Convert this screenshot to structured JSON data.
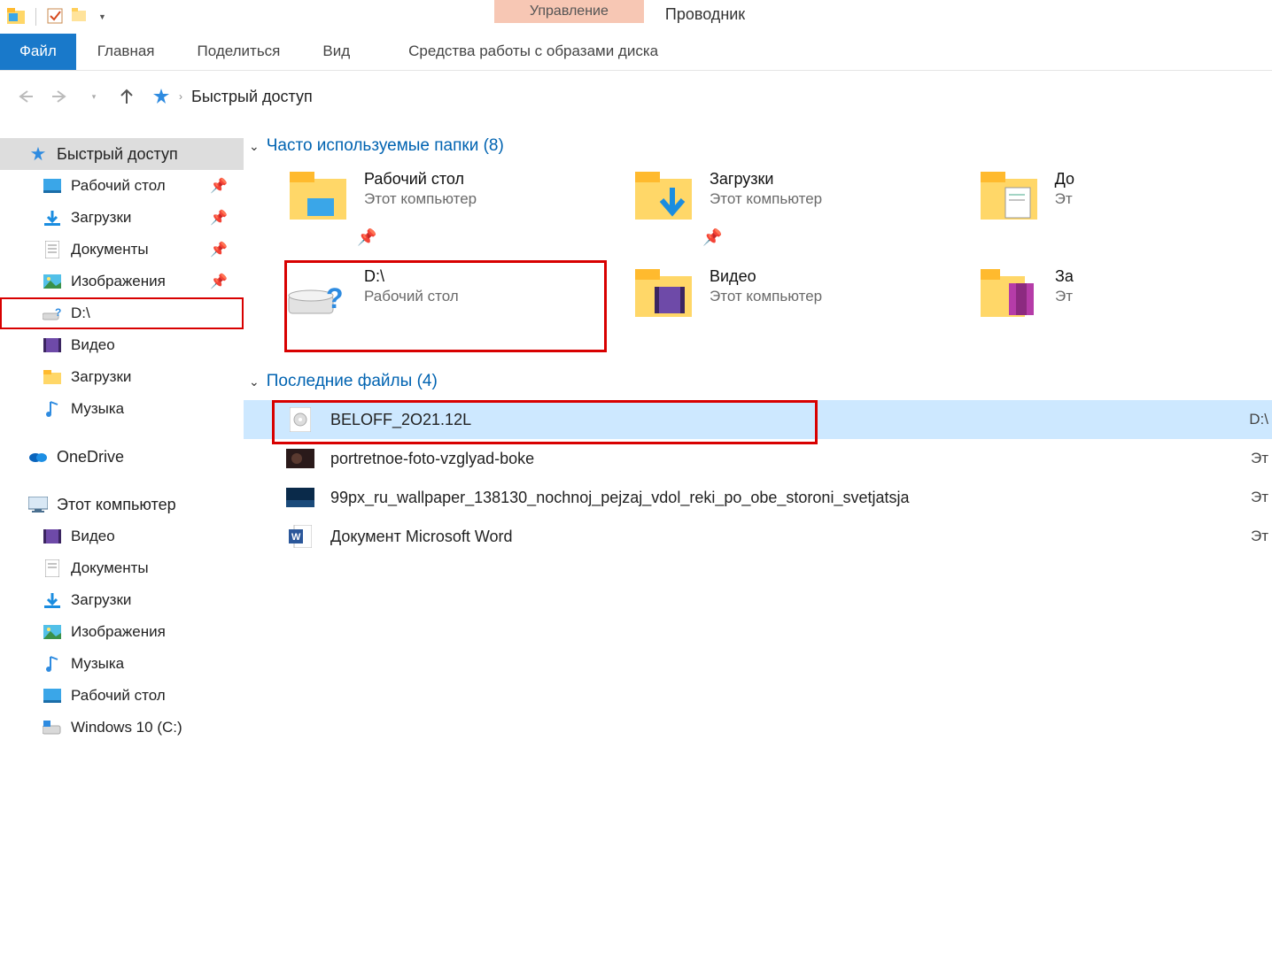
{
  "window": {
    "title": "Проводник",
    "contextual_tab_header": "Управление"
  },
  "ribbon": {
    "file": "Файл",
    "tabs": [
      "Главная",
      "Поделиться",
      "Вид"
    ],
    "contextual_tab": "Средства работы с образами диска"
  },
  "breadcrumb": {
    "location": "Быстрый доступ"
  },
  "sidebar": {
    "quick_access": {
      "label": "Быстрый доступ",
      "items": [
        {
          "label": "Рабочий стол",
          "icon": "desktop",
          "pinned": true
        },
        {
          "label": "Загрузки",
          "icon": "downloads",
          "pinned": true
        },
        {
          "label": "Документы",
          "icon": "documents",
          "pinned": true
        },
        {
          "label": "Изображения",
          "icon": "pictures",
          "pinned": true
        },
        {
          "label": "D:\\",
          "icon": "drive-question",
          "pinned": false,
          "highlighted": true
        },
        {
          "label": "Видео",
          "icon": "video",
          "pinned": false
        },
        {
          "label": "Загрузки",
          "icon": "folder",
          "pinned": false
        },
        {
          "label": "Музыка",
          "icon": "music",
          "pinned": false
        }
      ]
    },
    "onedrive": {
      "label": "OneDrive"
    },
    "this_pc": {
      "label": "Этот компьютер",
      "items": [
        {
          "label": "Видео",
          "icon": "video"
        },
        {
          "label": "Документы",
          "icon": "documents"
        },
        {
          "label": "Загрузки",
          "icon": "downloads"
        },
        {
          "label": "Изображения",
          "icon": "pictures"
        },
        {
          "label": "Музыка",
          "icon": "music"
        },
        {
          "label": "Рабочий стол",
          "icon": "desktop"
        },
        {
          "label": "Windows 10 (C:)",
          "icon": "drive"
        }
      ]
    }
  },
  "content": {
    "frequent_header": "Часто используемые папки (8)",
    "recent_header": "Последние файлы (4)",
    "frequent": [
      {
        "name": "Рабочий стол",
        "sub": "Этот компьютер",
        "icon": "folder-desktop",
        "pinned": true
      },
      {
        "name": "Загрузки",
        "sub": "Этот компьютер",
        "icon": "folder-downloads",
        "pinned": true
      },
      {
        "name": "До",
        "sub": "Эт",
        "icon": "folder-documents",
        "pinned": true
      },
      {
        "name": "D:\\",
        "sub": "Рабочий стол",
        "icon": "drive-question",
        "pinned": false,
        "highlighted": true
      },
      {
        "name": "Видео",
        "sub": "Этот компьютер",
        "icon": "folder-video",
        "pinned": false
      },
      {
        "name": "За",
        "sub": "Эт",
        "icon": "folder-archive",
        "pinned": false
      }
    ],
    "recent": [
      {
        "name": "BELOFF_2O21.12L",
        "icon": "iso",
        "location": "D:\\",
        "selected": true,
        "highlighted": true
      },
      {
        "name": "portretnoe-foto-vzglyad-boke",
        "icon": "image-dark",
        "location": "Эт"
      },
      {
        "name": "99px_ru_wallpaper_138130_nochnoj_pejzaj_vdol_reki_po_obe_storoni_svetjatsja",
        "icon": "image-blue",
        "location": "Эт"
      },
      {
        "name": "Документ Microsoft Word",
        "icon": "word",
        "location": "Эт"
      }
    ]
  }
}
